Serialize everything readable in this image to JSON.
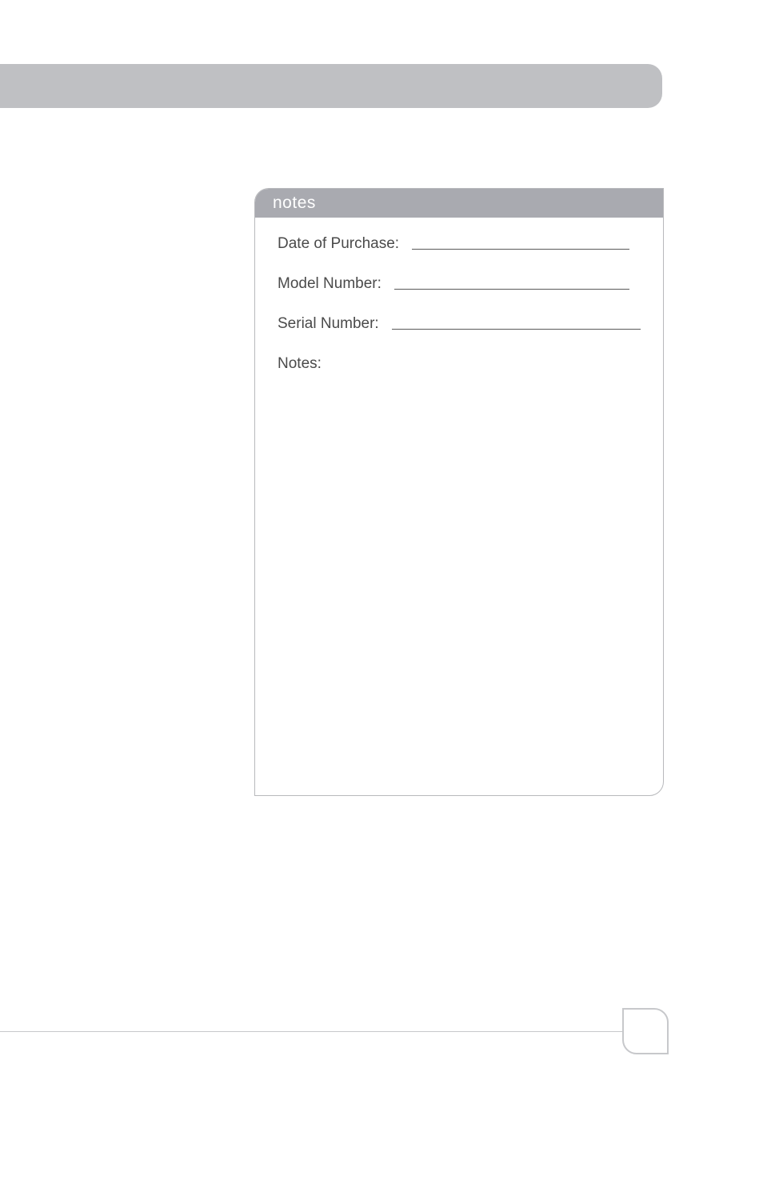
{
  "notesBox": {
    "title": "notes",
    "fields": {
      "dateOfPurchase": "Date of Purchase:",
      "modelNumber": "Model Number:",
      "serialNumber": "Serial Number:",
      "notes": "Notes:"
    }
  }
}
